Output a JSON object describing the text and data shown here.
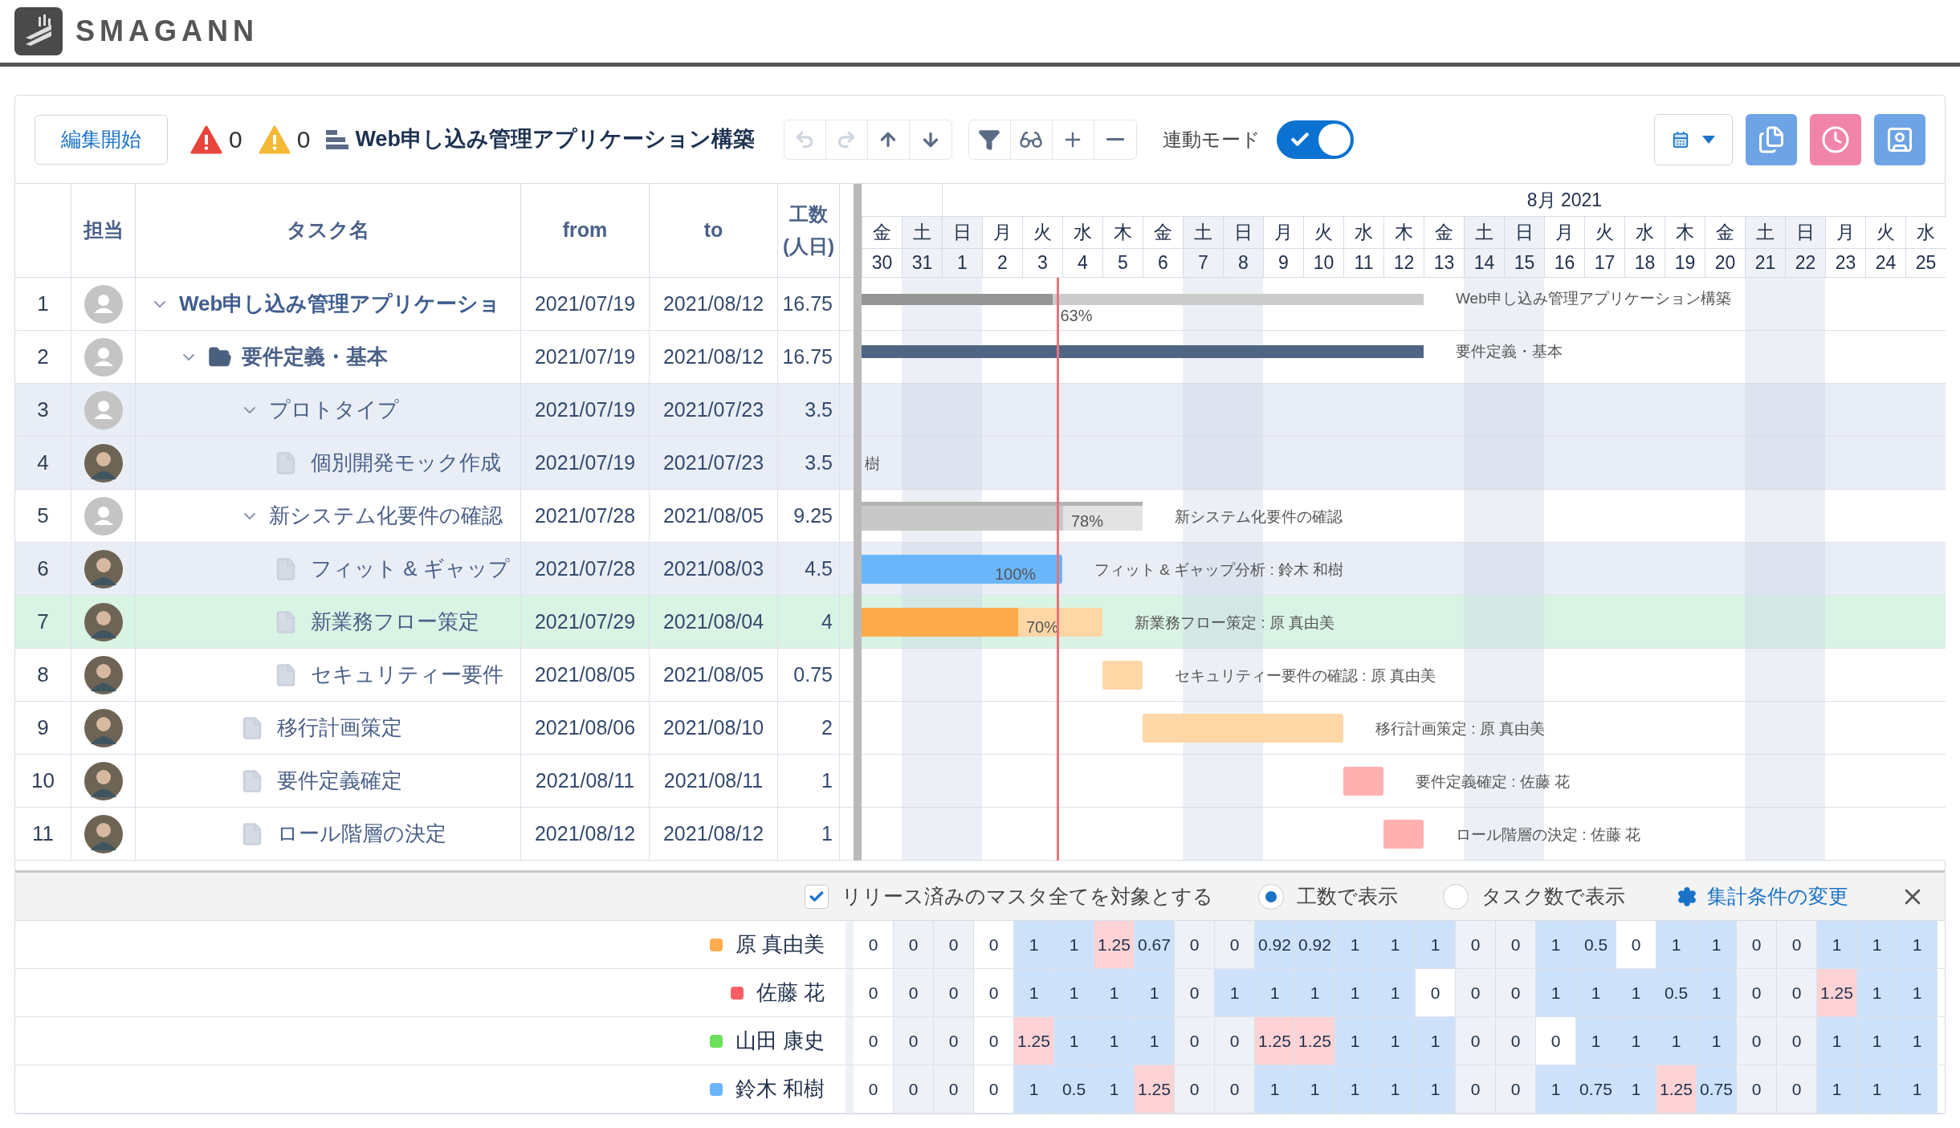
{
  "app": {
    "logo": "SMAGANN"
  },
  "toolbar": {
    "edit_button": "編集開始",
    "errors": "0",
    "warnings": "0",
    "project_title": "Web申し込み管理アプリケーション構築",
    "undo_disabled": true,
    "redo_disabled": true,
    "link_mode": {
      "label": "連動モード",
      "on": true
    }
  },
  "table": {
    "columns": {
      "assignee": "担当",
      "task": "タスク名",
      "from": "from",
      "to": "to",
      "effort": "工数\n(人日)"
    },
    "rows": [
      {
        "no": "1",
        "kind": "project",
        "avatar": {
          "kind": "placeholder"
        },
        "name": "Web申し込み管理アプリケーショ",
        "from": "2021/07/19",
        "to": "2021/08/12",
        "effort": "16.75",
        "expanded": true,
        "selected": false,
        "shaded": false,
        "bar": {
          "kind": "project",
          "color": "#cbcbcb",
          "fill": {
            "color": "#959595",
            "level": 0.63
          },
          "progress": "63%"
        },
        "gantt_label": "Web申し込み管理アプリケーション構築",
        "children": [
          {
            "no": "2",
            "kind": "folder",
            "avatar": {
              "kind": "placeholder"
            },
            "name": "要件定義・基本",
            "from": "2021/07/19",
            "to": "2021/08/12",
            "effort": "16.75",
            "expanded": true,
            "selected": false,
            "shaded": false,
            "bar": {
              "kind": "summary",
              "color": "#506584"
            },
            "gantt_label": "要件定義・基本",
            "children": [
              {
                "no": "3",
                "kind": "group",
                "avatar": {
                  "kind": "placeholder"
                },
                "name": "プロトタイプ",
                "from": "2021/07/19",
                "to": "2021/07/23",
                "effort": "3.5",
                "expanded": true,
                "selected": false,
                "shaded": true,
                "children": [
                  {
                    "no": "4",
                    "kind": "task",
                    "avatar": {
                      "kind": "photo"
                    },
                    "name": "個別開発モック作成",
                    "from": "2021/07/19",
                    "to": "2021/07/23",
                    "effort": "3.5",
                    "selected": false,
                    "shaded": true,
                    "gantt_label": "樹"
                  }
                ]
              },
              {
                "no": "5",
                "kind": "group",
                "avatar": {
                  "kind": "placeholder"
                },
                "name": "新システム化要件の確認",
                "from": "2021/07/28",
                "to": "2021/08/05",
                "effort": "9.25",
                "expanded": true,
                "selected": false,
                "shaded": false,
                "bar": {
                  "kind": "phase",
                  "color": "#e3e3e3",
                  "fill": {
                    "color": "#c8c8c8",
                    "level": 0.78
                  },
                  "progress": "78%"
                },
                "gantt_label": "新システム化要件の確認",
                "children": [
                  {
                    "no": "6",
                    "kind": "task",
                    "avatar": {
                      "kind": "photo"
                    },
                    "name": "フィット & ギャップ",
                    "from": "2021/07/28",
                    "to": "2021/08/03",
                    "effort": "4.5",
                    "selected": false,
                    "shaded": true,
                    "bar": {
                      "kind": "task",
                      "color": "#6bb6fb",
                      "progress": "100%"
                    },
                    "gantt_label": "フィット & ギャップ分析 : 鈴木 和樹"
                  },
                  {
                    "no": "7",
                    "kind": "task",
                    "avatar": {
                      "kind": "photo"
                    },
                    "name": "新業務フロー策定",
                    "from": "2021/07/29",
                    "to": "2021/08/04",
                    "effort": "4",
                    "selected": true,
                    "shaded": false,
                    "bar": {
                      "kind": "task",
                      "color": "#ffd7a6",
                      "fill": {
                        "color": "#ffab4c",
                        "level": 0.7
                      },
                      "progress": "70%"
                    },
                    "gantt_label": "新業務フロー策定 : 原 真由美"
                  },
                  {
                    "no": "8",
                    "kind": "task",
                    "avatar": {
                      "kind": "photo"
                    },
                    "name": "セキュリティー要件",
                    "from": "2021/08/05",
                    "to": "2021/08/05",
                    "effort": "0.75",
                    "selected": false,
                    "shaded": false,
                    "bar": {
                      "kind": "task",
                      "color": "#ffd7a6"
                    },
                    "gantt_label": "セキュリティー要件の確認 : 原 真由美"
                  }
                ]
              },
              {
                "no": "9",
                "kind": "task",
                "avatar": {
                  "kind": "photo"
                },
                "name": "移行計画策定",
                "from": "2021/08/06",
                "to": "2021/08/10",
                "effort": "2",
                "selected": false,
                "shaded": false,
                "bar": {
                  "kind": "task",
                  "color": "#ffd7a6"
                },
                "gantt_label": "移行計画策定 : 原 真由美"
              },
              {
                "no": "10",
                "kind": "task",
                "avatar": {
                  "kind": "photo"
                },
                "name": "要件定義確定",
                "from": "2021/08/11",
                "to": "2021/08/11",
                "effort": "1",
                "selected": false,
                "shaded": false,
                "bar": {
                  "kind": "task",
                  "color": "#ffb0b0"
                },
                "gantt_label": "要件定義確定 : 佐藤 花"
              },
              {
                "no": "11",
                "kind": "task",
                "avatar": {
                  "kind": "photo"
                },
                "name": "ロール階層の決定",
                "from": "2021/08/12",
                "to": "2021/08/12",
                "effort": "1",
                "selected": false,
                "shaded": false,
                "bar": {
                  "kind": "task",
                  "color": "#ffb0b0"
                },
                "gantt_label": "ロール階層の決定 : 佐藤 花"
              }
            ]
          }
        ]
      }
    ]
  },
  "gantt": {
    "month": "8月 2021",
    "previous_month_days": [
      {
        "weekday": "金",
        "day": "30",
        "weekend": false,
        "today": false
      },
      {
        "weekday": "土",
        "day": "31",
        "weekend": true,
        "today": false
      }
    ],
    "days": [
      {
        "weekday": "日",
        "day": "1",
        "weekend": true,
        "today": false
      },
      {
        "weekday": "月",
        "day": "2",
        "weekend": false,
        "today": false
      },
      {
        "weekday": "火",
        "day": "3",
        "weekend": false,
        "today": true
      },
      {
        "weekday": "水",
        "day": "4",
        "weekend": false,
        "today": false
      },
      {
        "weekday": "木",
        "day": "5",
        "weekend": false,
        "today": false
      },
      {
        "weekday": "金",
        "day": "6",
        "weekend": false,
        "today": false
      },
      {
        "weekday": "土",
        "day": "7",
        "weekend": true,
        "today": false
      },
      {
        "weekday": "日",
        "day": "8",
        "weekend": true,
        "today": false
      },
      {
        "weekday": "月",
        "day": "9",
        "weekend": false,
        "today": false
      },
      {
        "weekday": "火",
        "day": "10",
        "weekend": false,
        "today": false
      },
      {
        "weekday": "水",
        "day": "11",
        "weekend": false,
        "today": false
      },
      {
        "weekday": "木",
        "day": "12",
        "weekend": false,
        "today": false
      },
      {
        "weekday": "金",
        "day": "13",
        "weekend": false,
        "today": false
      },
      {
        "weekday": "土",
        "day": "14",
        "weekend": true,
        "today": false
      },
      {
        "weekday": "日",
        "day": "15",
        "weekend": true,
        "today": false
      },
      {
        "weekday": "月",
        "day": "16",
        "weekend": false,
        "today": false
      },
      {
        "weekday": "火",
        "day": "17",
        "weekend": false,
        "today": false
      },
      {
        "weekday": "水",
        "day": "18",
        "weekend": false,
        "today": false
      },
      {
        "weekday": "木",
        "day": "19",
        "weekend": false,
        "today": false
      },
      {
        "weekday": "金",
        "day": "20",
        "weekend": false,
        "today": false
      },
      {
        "weekday": "土",
        "day": "21",
        "weekend": true,
        "today": false
      },
      {
        "weekday": "日",
        "day": "22",
        "weekend": true,
        "today": false
      },
      {
        "weekday": "月",
        "day": "23",
        "weekend": false,
        "today": false
      },
      {
        "weekday": "火",
        "day": "24",
        "weekend": false,
        "today": false
      },
      {
        "weekday": "水",
        "day": "25",
        "weekend": false,
        "today": false
      }
    ]
  },
  "workload": {
    "include_released": {
      "label": "リリース済みのマスタ全てを対象とする",
      "checked": true
    },
    "display_mode": [
      {
        "label": "工数で表示",
        "selected": true
      },
      {
        "label": "タスク数で表示",
        "selected": false
      }
    ],
    "settings_link": "集計条件の変更",
    "people": [
      {
        "name": "原 真由美",
        "color": "#ffad4d",
        "cells": [
          {
            "value": "0",
            "kind": "free"
          },
          {
            "value": "0",
            "kind": "off"
          },
          {
            "value": "0",
            "kind": "off"
          },
          {
            "value": "0",
            "kind": "free"
          },
          {
            "value": "1",
            "kind": "work"
          },
          {
            "value": "1",
            "kind": "work"
          },
          {
            "value": "1.25",
            "kind": "over"
          },
          {
            "value": "0.67",
            "kind": "work"
          },
          {
            "value": "0",
            "kind": "off"
          },
          {
            "value": "0",
            "kind": "off"
          },
          {
            "value": "0.92",
            "kind": "work"
          },
          {
            "value": "0.92",
            "kind": "work"
          },
          {
            "value": "1",
            "kind": "work"
          },
          {
            "value": "1",
            "kind": "work"
          },
          {
            "value": "1",
            "kind": "work"
          },
          {
            "value": "0",
            "kind": "off"
          },
          {
            "value": "0",
            "kind": "off"
          },
          {
            "value": "1",
            "kind": "work"
          },
          {
            "value": "0.5",
            "kind": "work"
          },
          {
            "value": "0",
            "kind": "free"
          },
          {
            "value": "1",
            "kind": "work"
          },
          {
            "value": "1",
            "kind": "work"
          },
          {
            "value": "0",
            "kind": "off"
          },
          {
            "value": "0",
            "kind": "off"
          },
          {
            "value": "1",
            "kind": "work"
          },
          {
            "value": "1",
            "kind": "work"
          },
          {
            "value": "1",
            "kind": "work"
          }
        ]
      },
      {
        "name": "佐藤 花",
        "color": "#f95f62",
        "cells": [
          {
            "value": "0",
            "kind": "free"
          },
          {
            "value": "0",
            "kind": "off"
          },
          {
            "value": "0",
            "kind": "off"
          },
          {
            "value": "0",
            "kind": "free"
          },
          {
            "value": "1",
            "kind": "work"
          },
          {
            "value": "1",
            "kind": "work"
          },
          {
            "value": "1",
            "kind": "work"
          },
          {
            "value": "1",
            "kind": "work"
          },
          {
            "value": "0",
            "kind": "off"
          },
          {
            "value": "1",
            "kind": "work"
          },
          {
            "value": "1",
            "kind": "work"
          },
          {
            "value": "1",
            "kind": "work"
          },
          {
            "value": "1",
            "kind": "work"
          },
          {
            "value": "1",
            "kind": "work"
          },
          {
            "value": "0",
            "kind": "free"
          },
          {
            "value": "0",
            "kind": "off"
          },
          {
            "value": "0",
            "kind": "off"
          },
          {
            "value": "1",
            "kind": "work"
          },
          {
            "value": "1",
            "kind": "work"
          },
          {
            "value": "1",
            "kind": "work"
          },
          {
            "value": "0.5",
            "kind": "work"
          },
          {
            "value": "1",
            "kind": "work"
          },
          {
            "value": "0",
            "kind": "off"
          },
          {
            "value": "0",
            "kind": "off"
          },
          {
            "value": "1.25",
            "kind": "over"
          },
          {
            "value": "1",
            "kind": "work"
          },
          {
            "value": "1",
            "kind": "work"
          }
        ]
      },
      {
        "name": "山田 康史",
        "color": "#6be05a",
        "cells": [
          {
            "value": "0",
            "kind": "free"
          },
          {
            "value": "0",
            "kind": "off"
          },
          {
            "value": "0",
            "kind": "off"
          },
          {
            "value": "0",
            "kind": "free"
          },
          {
            "value": "1.25",
            "kind": "over"
          },
          {
            "value": "1",
            "kind": "work"
          },
          {
            "value": "1",
            "kind": "work"
          },
          {
            "value": "1",
            "kind": "work"
          },
          {
            "value": "0",
            "kind": "off"
          },
          {
            "value": "0",
            "kind": "off"
          },
          {
            "value": "1.25",
            "kind": "over"
          },
          {
            "value": "1.25",
            "kind": "over"
          },
          {
            "value": "1",
            "kind": "work"
          },
          {
            "value": "1",
            "kind": "work"
          },
          {
            "value": "1",
            "kind": "work"
          },
          {
            "value": "0",
            "kind": "off"
          },
          {
            "value": "0",
            "kind": "off"
          },
          {
            "value": "0",
            "kind": "free"
          },
          {
            "value": "1",
            "kind": "work"
          },
          {
            "value": "1",
            "kind": "work"
          },
          {
            "value": "1",
            "kind": "work"
          },
          {
            "value": "1",
            "kind": "work"
          },
          {
            "value": "0",
            "kind": "off"
          },
          {
            "value": "0",
            "kind": "off"
          },
          {
            "value": "1",
            "kind": "work"
          },
          {
            "value": "1",
            "kind": "work"
          },
          {
            "value": "1",
            "kind": "work"
          }
        ]
      },
      {
        "name": "鈴木 和樹",
        "color": "#6bb6fb",
        "cells": [
          {
            "value": "0",
            "kind": "free"
          },
          {
            "value": "0",
            "kind": "off"
          },
          {
            "value": "0",
            "kind": "off"
          },
          {
            "value": "0",
            "kind": "free"
          },
          {
            "value": "1",
            "kind": "work"
          },
          {
            "value": "0.5",
            "kind": "work"
          },
          {
            "value": "1",
            "kind": "work"
          },
          {
            "value": "1.25",
            "kind": "over"
          },
          {
            "value": "0",
            "kind": "off"
          },
          {
            "value": "0",
            "kind": "off"
          },
          {
            "value": "1",
            "kind": "work"
          },
          {
            "value": "1",
            "kind": "work"
          },
          {
            "value": "1",
            "kind": "work"
          },
          {
            "value": "1",
            "kind": "work"
          },
          {
            "value": "1",
            "kind": "work"
          },
          {
            "value": "0",
            "kind": "off"
          },
          {
            "value": "0",
            "kind": "off"
          },
          {
            "value": "1",
            "kind": "work"
          },
          {
            "value": "0.75",
            "kind": "work"
          },
          {
            "value": "1",
            "kind": "work"
          },
          {
            "value": "1.25",
            "kind": "over"
          },
          {
            "value": "0.75",
            "kind": "work"
          },
          {
            "value": "0",
            "kind": "off"
          },
          {
            "value": "0",
            "kind": "off"
          },
          {
            "value": "1",
            "kind": "work"
          },
          {
            "value": "1",
            "kind": "work"
          },
          {
            "value": "1",
            "kind": "work"
          }
        ]
      }
    ]
  }
}
